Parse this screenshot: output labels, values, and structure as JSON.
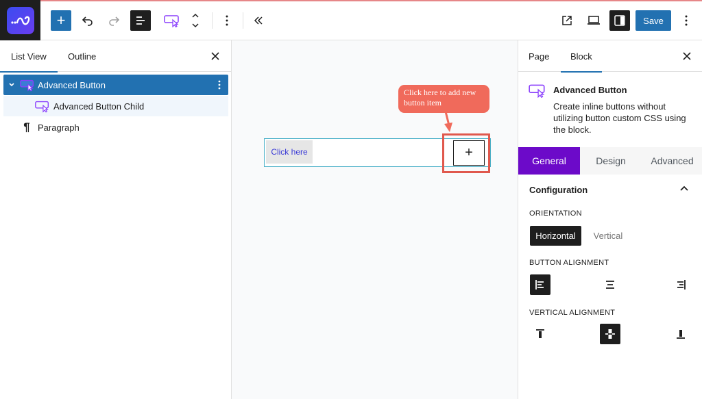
{
  "toolbar": {
    "add_label": "+",
    "save_label": "Save"
  },
  "left_panel": {
    "tabs": [
      "List View",
      "Outline"
    ],
    "items": [
      {
        "label": "Advanced Button"
      },
      {
        "label": "Advanced Button Child"
      },
      {
        "label": "Paragraph"
      }
    ]
  },
  "canvas": {
    "button_text": "Click here",
    "plus_label": "+",
    "callout_text": "Click here to add new button item"
  },
  "right_panel": {
    "tabs": [
      "Page",
      "Block"
    ],
    "block_title": "Advanced Button",
    "block_description": "Create inline buttons without utilizing button custom CSS using the block.",
    "sub_tabs": [
      "General",
      "Design",
      "Advanced"
    ],
    "section_title": "Configuration",
    "orientation_label": "ORIENTATION",
    "orientation_options": [
      "Horizontal",
      "Vertical"
    ],
    "button_alignment_label": "BUTTON ALIGNMENT",
    "vertical_alignment_label": "VERTICAL ALIGNMENT"
  },
  "colors": {
    "primary_blue": "#2271b1",
    "purple_tab": "#6c0ac9",
    "callout_red": "#f06a5b",
    "block_icon_purple": "#8a3ffc"
  },
  "icons": {
    "logo": "ab-logo-icon",
    "undo": "undo-icon",
    "redo": "redo-icon",
    "list_view": "list-view-icon",
    "block_type": "advanced-button-icon",
    "move": "move-up-down-icon",
    "options": "more-vertical-icon",
    "collapse": "double-chevron-left-icon",
    "external": "external-link-icon",
    "preview": "desktop-preview-icon",
    "settings": "settings-sidebar-icon",
    "close": "close-icon",
    "paragraph": "paragraph-icon"
  }
}
